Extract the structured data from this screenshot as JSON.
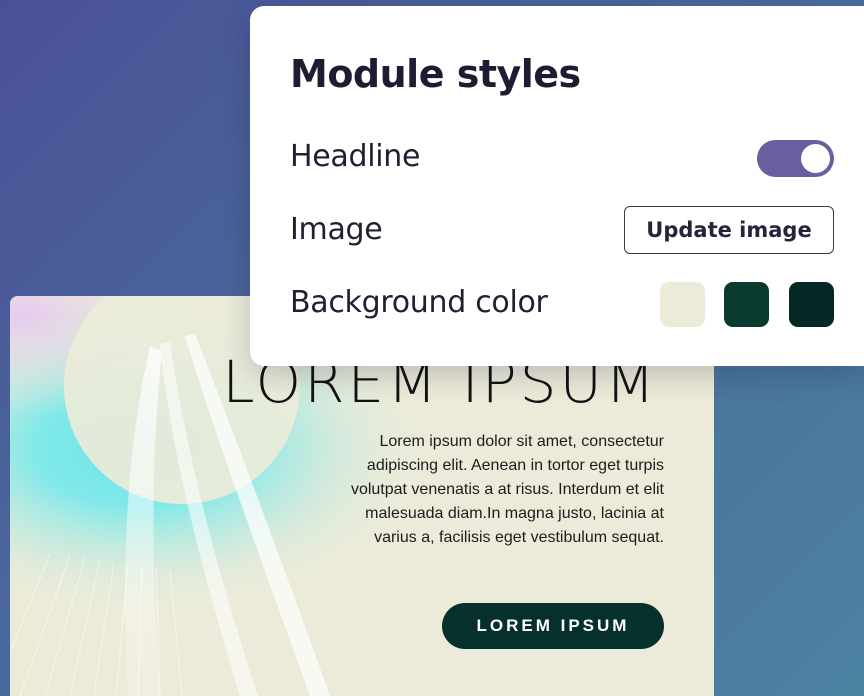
{
  "panel": {
    "title": "Module styles",
    "rows": {
      "headline": {
        "label": "Headline",
        "toggle_on": true
      },
      "image": {
        "label": "Image",
        "button_label": "Update image"
      },
      "background": {
        "label": "Background color"
      }
    },
    "swatches": [
      "#ecebd9",
      "#0b3a30",
      "#062824"
    ],
    "toggle_color": "#675f9f"
  },
  "preview": {
    "headline": "LOREM IPSUM",
    "body": "Lorem ipsum dolor sit amet, consectetur adipiscing elit. Aenean in tortor eget turpis volutpat venenatis a at risus. Interdum et elit malesuada diam.In magna justo, lacinia at varius a, facilisis eget vestibulum sequat.",
    "cta_label": "LOREM IPSUM",
    "background_color": "#ecebd9",
    "cta_color": "#06302c"
  }
}
